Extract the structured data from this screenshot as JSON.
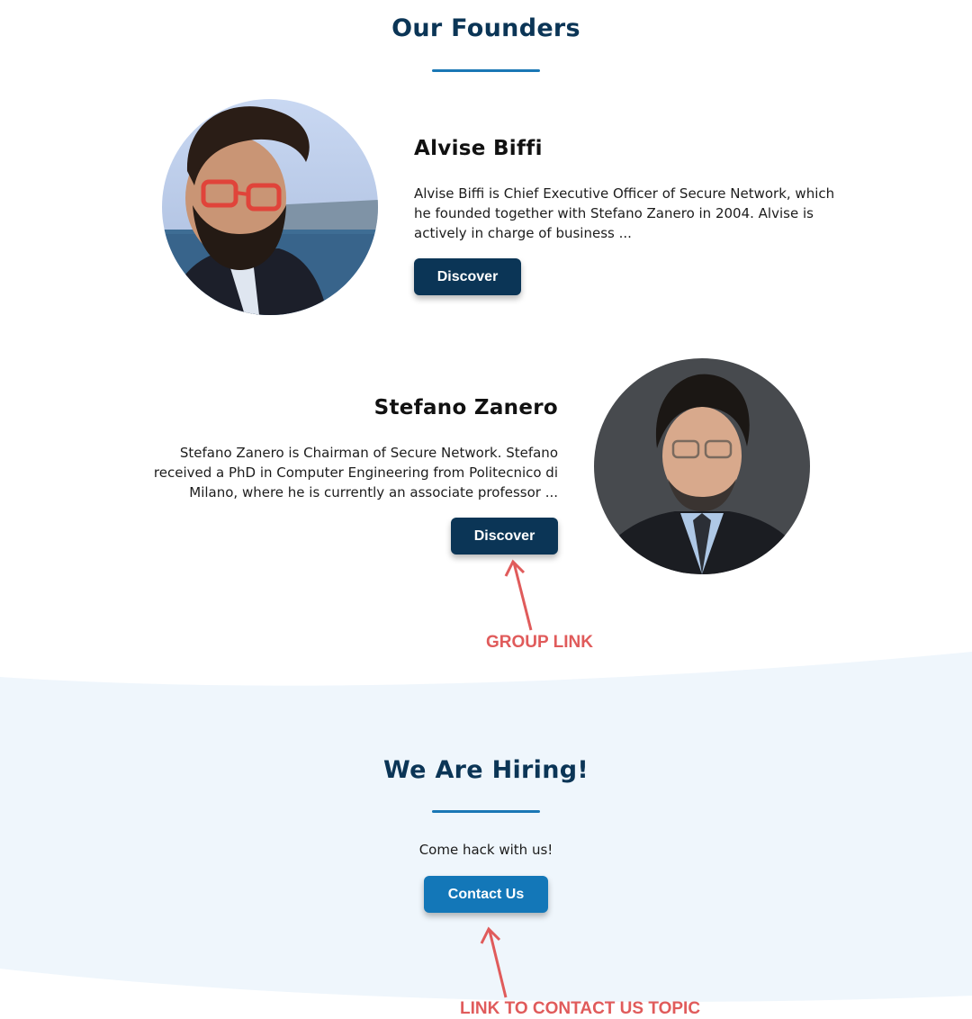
{
  "founders": {
    "title": "Our Founders",
    "people": [
      {
        "name": "Alvise Biffi",
        "bio": "Alvise Biffi is Chief Executive Officer of Secure Network, which he founded together with Stefano Zanero in 2004. Alvise is actively in charge of business ...",
        "button_label": "Discover"
      },
      {
        "name": "Stefano Zanero",
        "bio": "Stefano Zanero is Chairman of Secure Network. Stefano received a PhD in Computer Engineering from Politecnico di Milano, where he is currently an associate professor ...",
        "button_label": "Discover"
      }
    ]
  },
  "annotations": {
    "group_link": "GROUP LINK",
    "contact_link": "LINK TO CONTACT US TOPIC"
  },
  "hiring": {
    "title": "We Are Hiring!",
    "tagline": "Come hack with us!",
    "button_label": "Contact Us"
  },
  "colors": {
    "navy": "#0b3556",
    "accent_blue": "#1377b8",
    "light_bg": "#eff6fc",
    "annotation_red": "#e05b5b"
  }
}
